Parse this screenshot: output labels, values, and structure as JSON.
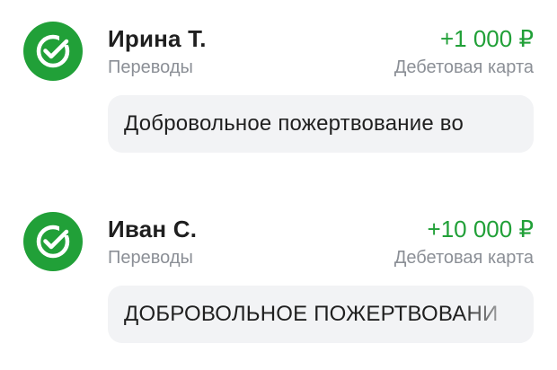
{
  "colors": {
    "accent": "#21a038",
    "text_primary": "#1f1f1f",
    "text_secondary": "#8b8f96",
    "message_bg": "#f2f3f5"
  },
  "transactions": [
    {
      "icon": "sber-check-icon",
      "name": "Ирина Т.",
      "category": "Переводы",
      "amount": "+1 000 ₽",
      "account": "Дебетовая карта",
      "message": "Добровольное пожертвование во"
    },
    {
      "icon": "sber-check-icon",
      "name": "Иван С.",
      "category": "Переводы",
      "amount": "+10 000 ₽",
      "account": "Дебетовая карта",
      "message": "ДОБРОВОЛЬНОЕ ПОЖЕРТВОВАНИ"
    }
  ]
}
